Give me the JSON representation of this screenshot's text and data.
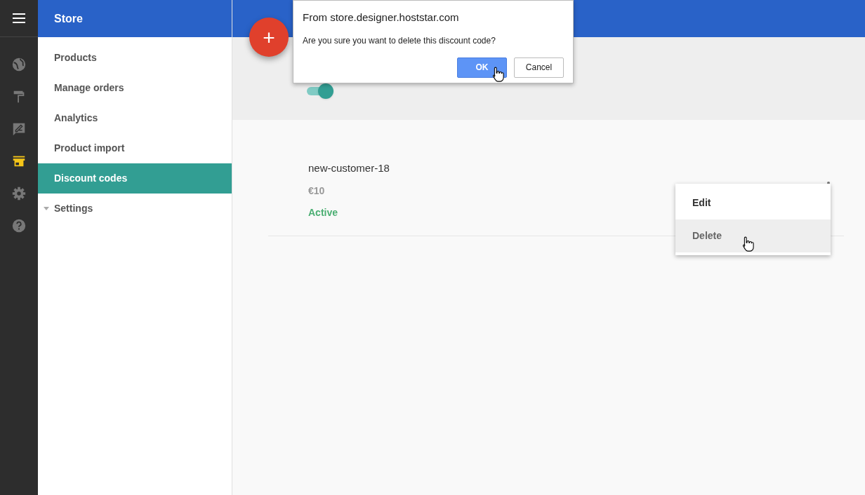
{
  "app_bar": {
    "title": "Store"
  },
  "rail": [
    {
      "kind": "globe",
      "selected": false
    },
    {
      "kind": "roller",
      "selected": false
    },
    {
      "kind": "feedback",
      "selected": false
    },
    {
      "kind": "store",
      "selected": true
    },
    {
      "kind": "gear",
      "selected": false
    },
    {
      "kind": "help",
      "selected": false
    }
  ],
  "sidebar": {
    "items": [
      {
        "label": "Products",
        "selected": false
      },
      {
        "label": "Manage orders",
        "selected": false
      },
      {
        "label": "Analytics",
        "selected": false
      },
      {
        "label": "Product import",
        "selected": false
      },
      {
        "label": "Discount codes",
        "selected": true
      },
      {
        "label": "Settings",
        "selected": false,
        "expandable": true
      }
    ]
  },
  "fab": {
    "label": "+"
  },
  "toggle": {
    "on": true
  },
  "discount": {
    "code": "new-customer-18",
    "amount": "€10",
    "status": "Active"
  },
  "menu": {
    "items": [
      {
        "label": "Edit",
        "selected": false
      },
      {
        "label": "Delete",
        "selected": true
      }
    ]
  },
  "dialog": {
    "title": "From store.designer.hoststar.com",
    "message": "Are you sure you want to delete this discount code?",
    "buttons": [
      {
        "label": "OK",
        "primary": true
      },
      {
        "label": "Cancel",
        "primary": false
      }
    ]
  }
}
